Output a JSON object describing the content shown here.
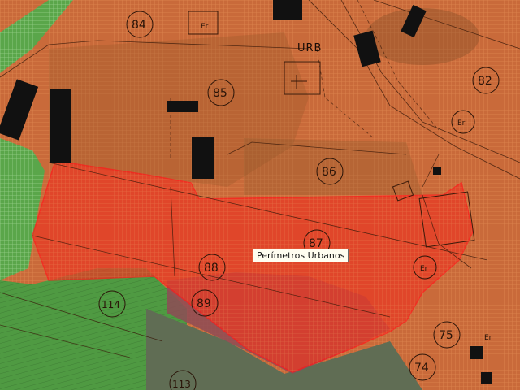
{
  "tooltip": {
    "text": "Perímetros Urbanos"
  },
  "labels": {
    "urb": "URB",
    "p84": "84",
    "p85": "85",
    "p86": "86",
    "p87": "87",
    "p88": "88",
    "p89": "89",
    "p82": "82",
    "p75": "75",
    "p74": "74",
    "p114": "114",
    "p113": "113",
    "er1": "Er",
    "er2": "Er",
    "er3": "Er",
    "er4": "Er"
  },
  "colors": {
    "urban_zone": "#c96a3a",
    "highlight_perimeter": "#e83a25",
    "highlight_border": "#ff1a1a",
    "green_zone": "#5aa64a",
    "purple_zone": "#8e4b56",
    "building": "#111111"
  }
}
